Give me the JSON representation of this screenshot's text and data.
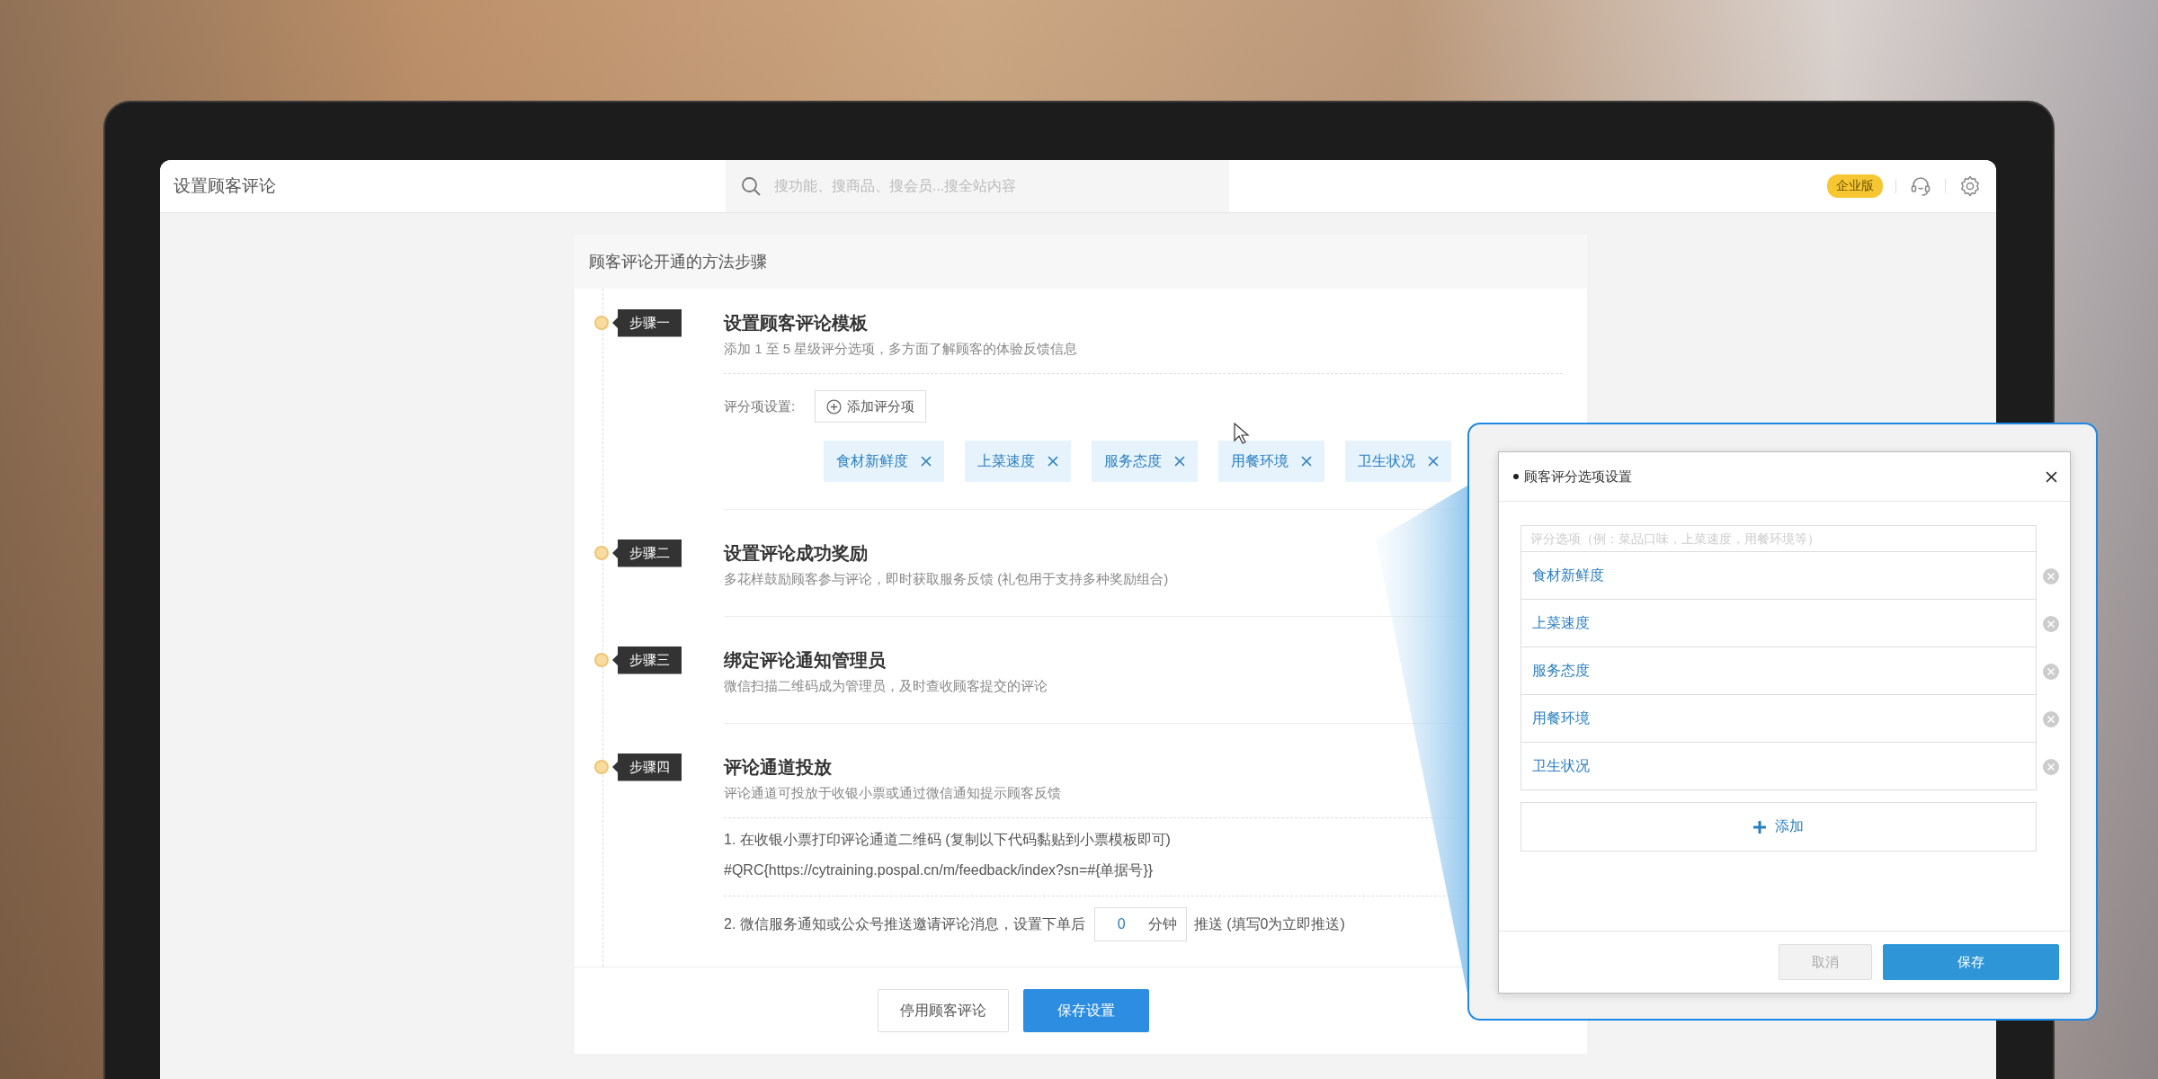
{
  "header": {
    "title": "设置顾客评论",
    "search": {
      "placeholder": "搜功能、搜商品、搜会员...搜全站内容"
    },
    "badge": "企业版"
  },
  "card": {
    "title": "顾客评论开通的方法步骤",
    "steps": [
      {
        "kind": "rating_items",
        "tag": "步骤一",
        "title": "设置顾客评论模板",
        "description": "添加 1 至 5 星级评分选项，多方面了解顾客的体验反馈信息",
        "field_label": "评分项设置:",
        "add_button": "添加评分项",
        "tags": [
          "食材新鲜度",
          "上菜速度",
          "服务态度",
          "用餐环境",
          "卫生状况"
        ]
      },
      {
        "kind": "plain",
        "tag": "步骤二",
        "title": "设置评论成功奖励",
        "description": "多花样鼓励顾客参与评论，即时获取服务反馈 (礼包用于支持多种奖励组合)"
      },
      {
        "kind": "plain",
        "tag": "步骤三",
        "title": "绑定评论通知管理员",
        "description": "微信扫描二维码成为管理员，及时查收顾客提交的评论"
      },
      {
        "kind": "channels",
        "tag": "步骤四",
        "title": "评论通道投放",
        "description": "评论通道可投放于收银小票或通过微信通知提示顾客反馈",
        "qr_line": "1. 在收银小票打印评论通道二维码 (复制以下代码黏贴到小票模板即可)",
        "qr_code": "#QRC{https://cytraining.pospal.cn/m/feedback/index?sn=#{单据号}}",
        "push_line": "2. 微信服务通知或公众号推送邀请评论消息，设置下单后",
        "push_value": "0",
        "push_unit": "分钟",
        "push_suffix": "推送 (填写0为立即推送)"
      }
    ],
    "buttons": [
      {
        "label": "停用顾客评论",
        "kind": "secondary"
      },
      {
        "label": "保存设置",
        "kind": "primary"
      }
    ]
  },
  "dialog": {
    "title": "顾客评分选项设置",
    "placeholder": "评分选项（例：菜品口味，上菜速度，用餐环境等）",
    "items": [
      "食材新鲜度",
      "上菜速度",
      "服务态度",
      "用餐环境",
      "卫生状况"
    ],
    "add_button": "添加",
    "buttons": [
      {
        "label": "取消",
        "kind": "secondary"
      },
      {
        "label": "保存",
        "kind": "primary"
      }
    ]
  }
}
